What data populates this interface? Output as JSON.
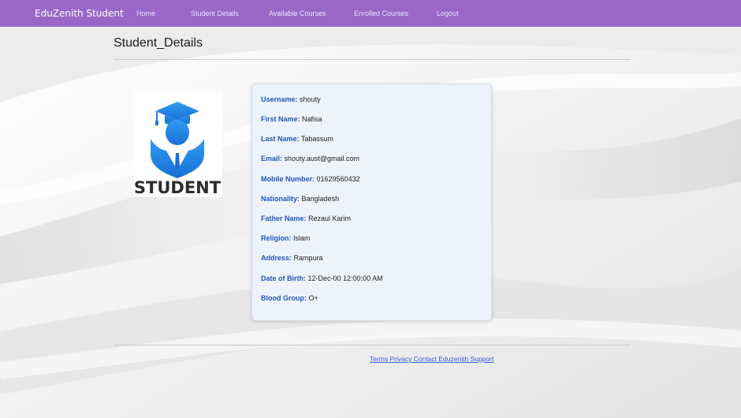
{
  "navbar": {
    "brand": "EduZenith Student",
    "items": [
      {
        "label": "Home"
      },
      {
        "label": "Student Details"
      },
      {
        "label": "Available Courses"
      },
      {
        "label": "Enrolled Courses"
      },
      {
        "label": "Logout"
      }
    ],
    "color": "#9a67c9"
  },
  "page": {
    "title": "Student_Details"
  },
  "profile": {
    "image_text": "STUDENT",
    "icon": "graduate-student-icon"
  },
  "details": [
    {
      "label": "Username:",
      "value": "shouty"
    },
    {
      "label": "First Name:",
      "value": "Nafisa"
    },
    {
      "label": "Last Name:",
      "value": "Tabassum"
    },
    {
      "label": "Email:",
      "value": "shouty.aust@gmail.com"
    },
    {
      "label": "Mobile Number:",
      "value": "01629560432"
    },
    {
      "label": "Nationality:",
      "value": "Bangladesh"
    },
    {
      "label": "Father Name:",
      "value": "Rezaul Karim"
    },
    {
      "label": "Religion:",
      "value": "Islam"
    },
    {
      "label": "Address:",
      "value": "Rampura"
    },
    {
      "label": "Date of Birth:",
      "value": "12-Dec-00 12:00:00 AM"
    },
    {
      "label": "Blood Group:",
      "value": "O+"
    }
  ],
  "footer": {
    "links_text": "Terms Privacy Contact Eduzenith Support"
  },
  "colors": {
    "label_blue": "#1e57b8",
    "card_bg": "#eef3fb",
    "link_blue": "#2a63d4"
  }
}
